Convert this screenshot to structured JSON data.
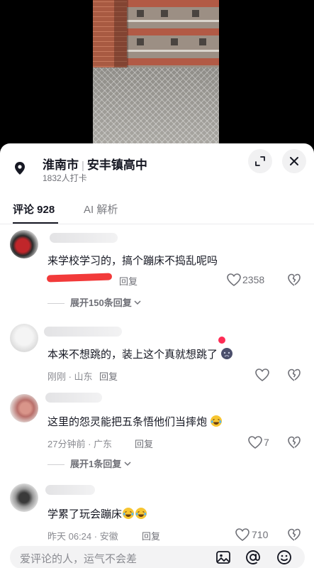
{
  "location": {
    "city": "淮南市",
    "place": "安丰镇高中",
    "checkins": "1832人打卡"
  },
  "tabs": {
    "comments": "评论 928",
    "ai": "AI 解析"
  },
  "comments": [
    {
      "text": "来学校学习的，搞个蹦床不捣乱呢吗",
      "reply_label": "回复",
      "likes": "2358",
      "expand": "展开150条回复"
    },
    {
      "text": "本来不想跳的，装上这个真就想跳了",
      "meta": "刚刚 · 山东",
      "reply_label": "回复"
    },
    {
      "text": "这里的怨灵能把五条悟他们当摔炮",
      "meta": "27分钟前 · 广东",
      "reply_label": "回复",
      "likes": "7",
      "expand": "展开1条回复"
    },
    {
      "text": "学累了玩会蹦床",
      "meta": "昨天 06:24 · 安徽",
      "reply_label": "回复",
      "likes": "710"
    }
  ],
  "input": {
    "placeholder": "爱评论的人，运气不会差"
  },
  "colors": {
    "accent_red": "#fe2c55",
    "text_primary": "#161823",
    "text_secondary": "#8a8b91"
  },
  "icons": [
    "location-pin-icon",
    "expand-icon",
    "close-icon",
    "heart-icon",
    "dislike-icon",
    "chevron-down-icon",
    "image-icon",
    "at-icon",
    "emoji-icon"
  ]
}
